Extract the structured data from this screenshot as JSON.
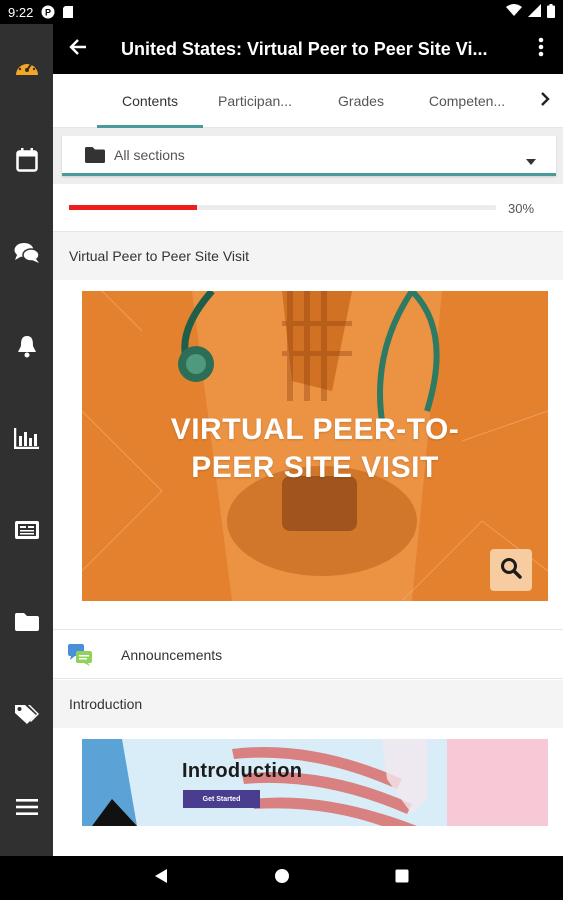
{
  "status_bar": {
    "time": "9:22",
    "icons": [
      "p-icon",
      "sd-card-icon",
      "wifi-icon",
      "signal-icon",
      "battery-icon"
    ]
  },
  "sidebar": {
    "items": [
      {
        "name": "dashboard",
        "icon": "speedometer-icon",
        "color": "#f5a623"
      },
      {
        "name": "calendar",
        "icon": "calendar-icon"
      },
      {
        "name": "messages",
        "icon": "chat-icon"
      },
      {
        "name": "notifications",
        "icon": "bell-icon"
      },
      {
        "name": "grades",
        "icon": "bar-chart-icon"
      },
      {
        "name": "badges",
        "icon": "id-card-icon"
      },
      {
        "name": "files",
        "icon": "folder-icon"
      },
      {
        "name": "tags",
        "icon": "tags-icon"
      },
      {
        "name": "menu",
        "icon": "hamburger-icon"
      }
    ]
  },
  "app_bar": {
    "title": "United States: Virtual Peer to Peer Site Vi...",
    "back_icon": "arrow-left-icon",
    "more_icon": "more-vert-icon"
  },
  "tabs": {
    "items": [
      {
        "label": "Contents",
        "active": true
      },
      {
        "label": "Participan...",
        "active": false
      },
      {
        "label": "Grades",
        "active": false
      },
      {
        "label": "Competen...",
        "active": false
      }
    ],
    "next_icon": "chevron-right-icon",
    "accent": "#4a9a9b"
  },
  "sections": {
    "selected": "All sections"
  },
  "progress": {
    "percent_text": "30%",
    "value": 0.3,
    "color": "#ee1c1c"
  },
  "course": {
    "section1_title": "Virtual Peer to Peer Site Visit",
    "banner_title_line1": "VIRTUAL PEER-TO-",
    "banner_title_line2": "PEER SITE VISIT",
    "banner_color": "#e4812e",
    "announcements_label": "Announcements",
    "section2_title": "Introduction",
    "intro_image_title": "Introduction",
    "intro_button_label": "Get Started"
  },
  "nav_bar": {
    "icons": [
      "back-triangle-icon",
      "home-circle-icon",
      "recents-square-icon"
    ]
  }
}
